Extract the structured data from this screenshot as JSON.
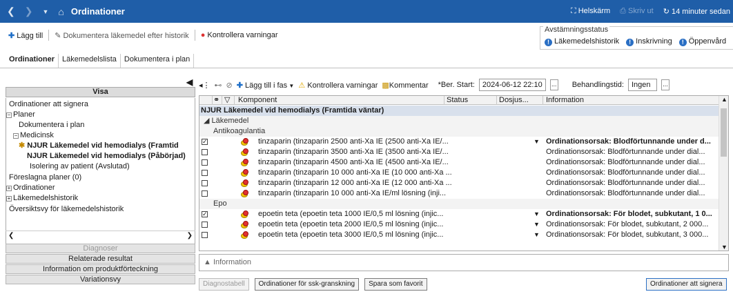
{
  "titlebar": {
    "title": "Ordinationer",
    "fullscreen": "Helskärm",
    "print": "Skriv ut",
    "refresh": "14 minuter sedan"
  },
  "toolbar": {
    "add": "Lägg till",
    "document_history": "Dokumentera läkemedel efter historik",
    "check_warnings": "Kontrollera varningar"
  },
  "reconciliation": {
    "label": "Avstämningsstatus",
    "items": [
      "Läkemedelshistorik",
      "Inskrivning",
      "Öppenvård"
    ]
  },
  "tabs": [
    "Ordinationer",
    "Läkemedelslista",
    "Dokumentera i plan"
  ],
  "left": {
    "header": "Visa",
    "tree": [
      "Ordinationer att signera",
      "Planer",
      "Dokumentera i plan",
      "Medicinsk",
      "NJUR Läkemedel vid hemodialys (Framtid",
      "NJUR Läkemedel vid hemodialys (Påbörjad)",
      "Isolering av patient (Avslutad)",
      "Föreslagna planer (0)",
      "Ordinationer",
      "Läkemedelshistorik",
      "Översiktsvy för läkemedelshistorik"
    ],
    "bottom_buttons": [
      "Diagnoser",
      "Relaterade resultat",
      "Information om produktförteckning",
      "Variationsvy"
    ]
  },
  "main_toolbar": {
    "add_phase": "Lägg till i fas",
    "check_warnings": "Kontrollera varningar",
    "comment": "Kommentar",
    "start_label": "*Ber. Start:",
    "start_value": "2024-06-12 22:10",
    "treatment_label": "Behandlingstid:",
    "treatment_value": "Ingen"
  },
  "grid": {
    "columns": [
      "Komponent",
      "Status",
      "Dosjus...",
      "Information"
    ],
    "group": "NJUR Läkemedel vid hemodialys (Framtida väntar)",
    "subgroup": "Läkemedel",
    "cat1": "Antikoagulantia",
    "cat2": "Epo",
    "rows1": [
      {
        "c": "tinzaparin (tinzaparin 2500 anti-Xa IE (2500 anti-Xa IE/...",
        "i": "Ordinationsorsak: Blodförtunnande under d..."
      },
      {
        "c": "tinzaparin (tinzaparin 3500 anti-Xa IE (3500 anti-Xa IE/...",
        "i": "Ordinationsorsak: Blodförtunnande under dial..."
      },
      {
        "c": "tinzaparin (tinzaparin 4500 anti-Xa IE (4500 anti-Xa IE/...",
        "i": "Ordinationsorsak: Blodförtunnande under dial..."
      },
      {
        "c": "tinzaparin (tinzaparin 10 000 anti-Xa IE (10 000 anti-Xa ...",
        "i": "Ordinationsorsak: Blodförtunnande under dial..."
      },
      {
        "c": "tinzaparin (tinzaparin 12 000 anti-Xa IE (12 000 anti-Xa ...",
        "i": "Ordinationsorsak: Blodförtunnande under dial..."
      },
      {
        "c": "tinzaparin (tinzaparin 10 000 anti-Xa IE/ml lösning (inji...",
        "i": "Ordinationsorsak: Blodförtunnande under dial..."
      }
    ],
    "rows2": [
      {
        "c": "epoetin teta (epoetin teta 1000 IE/0,5 ml lösning (injic...",
        "i": "Ordinationsorsak: För blodet, subkutant, 1 0..."
      },
      {
        "c": "epoetin teta (epoetin teta 2000 IE/0,5 ml lösning (injic...",
        "i": "Ordinationsorsak: För blodet, subkutant, 2 000..."
      },
      {
        "c": "epoetin teta (epoetin teta 3000 IE/0,5 ml lösning (injic...",
        "i": "Ordinationsorsak: För blodet, subkutant, 3 000..."
      }
    ]
  },
  "info_bar": "Information",
  "buttons": {
    "diag": "Diagnostabell",
    "ssk": "Ordinationer för ssk-granskning",
    "fav": "Spara som favorit",
    "sign": "Ordinationer att signera"
  }
}
